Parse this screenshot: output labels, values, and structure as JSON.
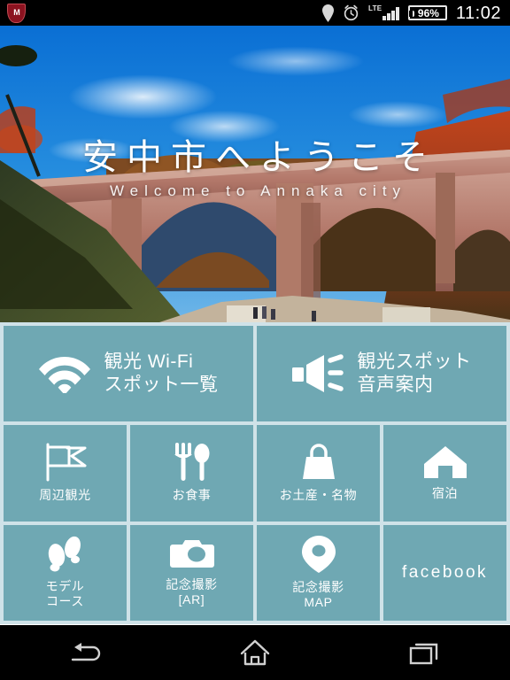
{
  "statusbar": {
    "notification_icon": "mcafee-shield-icon",
    "mcafee_mark": "M",
    "location_icon": "location-pin-icon",
    "alarm_icon": "alarm-clock-icon",
    "network_type": "LTE",
    "signal_icon": "signal-bars-icon",
    "battery_level": "96%",
    "time": "11:02"
  },
  "hero": {
    "title": "安中市へようこそ",
    "subtitle": "Welcome to Annaka city",
    "image_alt": "usui-pass-megane-bridge-photo"
  },
  "menu": {
    "wide_row": [
      {
        "icon": "wifi-icon",
        "label_line1": "観光 Wi-Fi",
        "label_line2": "スポット一覧"
      },
      {
        "icon": "speaker-icon",
        "label_line1": "観光スポット",
        "label_line2": "音声案内"
      }
    ],
    "row2": [
      {
        "icon": "flag-icon",
        "label_line1": "周辺観光",
        "label_line2": ""
      },
      {
        "icon": "cutlery-icon",
        "label_line1": "お食事",
        "label_line2": ""
      },
      {
        "icon": "shopping-bag-icon",
        "label_line1": "お土産・名物",
        "label_line2": ""
      },
      {
        "icon": "house-icon",
        "label_line1": "宿泊",
        "label_line2": ""
      }
    ],
    "row3": [
      {
        "icon": "footprints-icon",
        "label_line1": "モデル",
        "label_line2": "コース"
      },
      {
        "icon": "camera-icon",
        "label_line1": "記念撮影",
        "label_line2": "[AR]"
      },
      {
        "icon": "map-pin-icon",
        "label_line1": "記念撮影",
        "label_line2": "MAP"
      },
      {
        "icon": "",
        "label_line1": "facebook",
        "label_line2": ""
      }
    ]
  },
  "navbar": {
    "back": "back-icon",
    "home": "home-icon",
    "recents": "recents-icon"
  },
  "colors": {
    "tile": "#6fa8b3",
    "tile_gap": "#cfe2e8",
    "text_on_tile": "#ffffff",
    "status_bar": "#000000",
    "sky": "#1a74c8"
  }
}
